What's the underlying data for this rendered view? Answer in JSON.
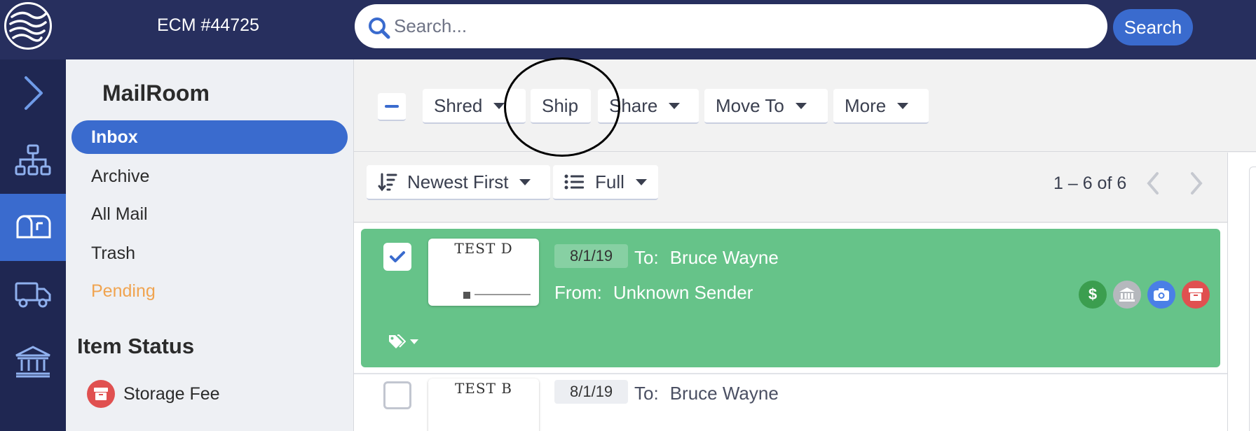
{
  "header": {
    "account": "ECM #44725",
    "search_placeholder": "Search...",
    "search_button": "Search"
  },
  "rail": {
    "items": [
      "expand-icon",
      "org-chart-icon",
      "mailbox-icon",
      "truck-icon",
      "bank-icon"
    ],
    "active": "mailbox-icon"
  },
  "sidebar": {
    "title": "MailRoom",
    "items": [
      {
        "label": "Inbox",
        "active": true
      },
      {
        "label": "Archive"
      },
      {
        "label": "All Mail"
      },
      {
        "label": "Trash"
      },
      {
        "label": "Pending"
      }
    ],
    "status_title": "Item Status",
    "status_items": [
      {
        "label": "Storage Fee",
        "icon": "archive-box-icon",
        "color": "#e05050"
      }
    ]
  },
  "toolbar": {
    "shred": "Shred",
    "ship": "Ship",
    "share": "Share",
    "move_to": "Move To",
    "more": "More"
  },
  "sortbar": {
    "sort": "Newest First",
    "view": "Full",
    "range": "1 – 6 of 6"
  },
  "mail_items": [
    {
      "thumb_text": "TEST D",
      "date": "8/1/19",
      "to_label": "To:",
      "to": "Bruce Wayne",
      "from_label": "From:",
      "from": "Unknown Sender",
      "selected": true,
      "badges": [
        {
          "icon": "dollar-icon",
          "color": "#3b9e4f"
        },
        {
          "icon": "bank-icon",
          "color": "#b5b8bd"
        },
        {
          "icon": "camera-icon",
          "color": "#4a7fe6"
        },
        {
          "icon": "archive-box-icon",
          "color": "#e05050"
        }
      ]
    },
    {
      "thumb_text": "TEST B",
      "date": "8/1/19",
      "to_label": "To:",
      "to": "Bruce Wayne",
      "selected": false
    }
  ],
  "colors": {
    "topbar": "#272f5e",
    "rail": "#1f2752",
    "accent": "#3a6bce",
    "selected_row": "#66c389",
    "pending": "#f0a450"
  }
}
